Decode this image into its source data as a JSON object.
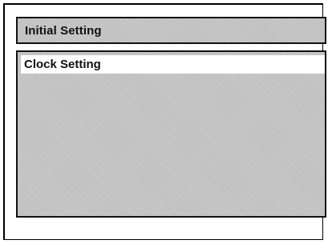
{
  "header": {
    "title": "Initial Setting"
  },
  "menu": {
    "items": [
      {
        "label": "Clock Setting",
        "selected": true
      }
    ]
  },
  "colors": {
    "background": "#ffffff",
    "panel_shade": "#c9c9c9",
    "highlight": "#ffffff",
    "border": "#111111"
  }
}
